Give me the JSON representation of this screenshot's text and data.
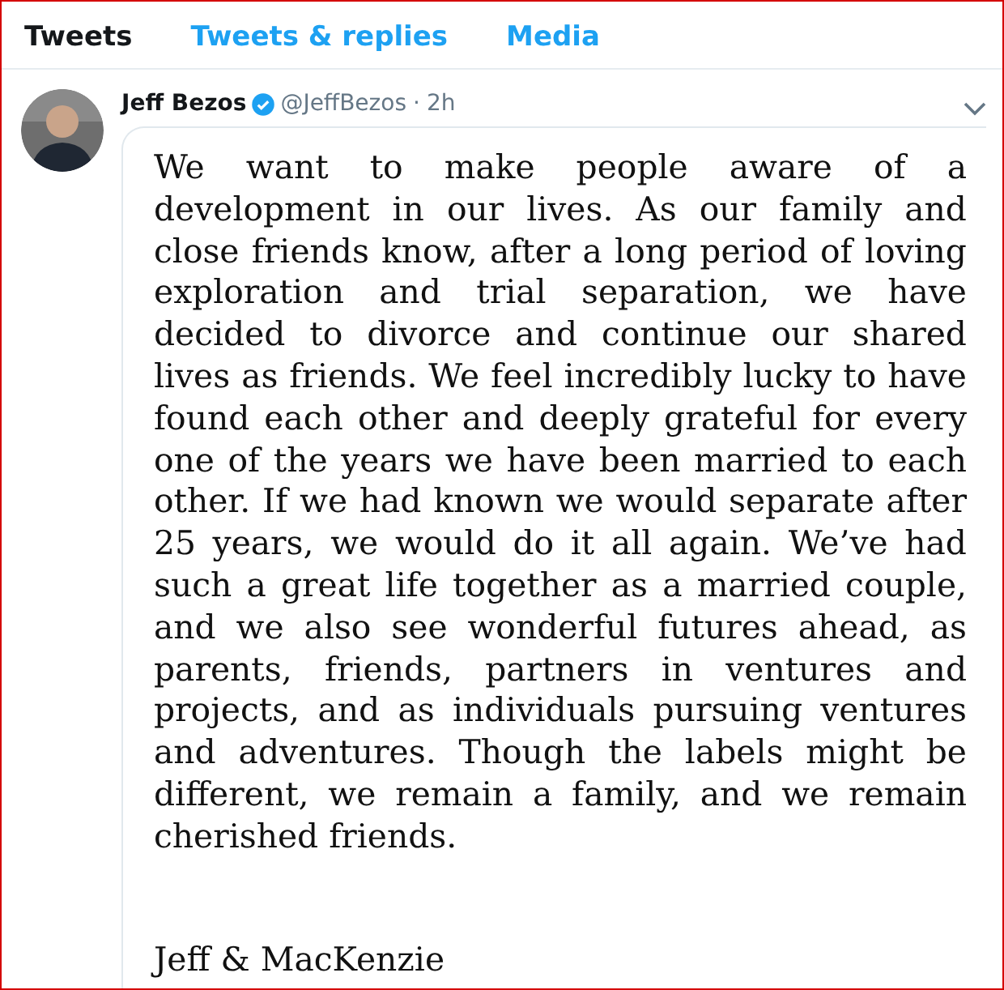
{
  "tabs": [
    {
      "label": "Tweets",
      "selected": true
    },
    {
      "label": "Tweets & replies",
      "selected": false
    },
    {
      "label": "Media",
      "selected": false
    }
  ],
  "tweet": {
    "author": "Jeff Bezos",
    "verified": true,
    "handle": "@JeffBezos",
    "separator": "·",
    "time": "2h",
    "statement": {
      "body": "We want to make people aware of a development in our lives. As our family and close friends know, after a long period of loving exploration and trial separation, we have decided to divorce and continue our shared lives as friends.  We feel incredibly lucky to have found each other and deeply grateful for every one of the years we have been married to each other.  If we had known we would separate after 25 years, we would do it all again.  We’ve had such a great life together as a married couple, and we also see wonderful futures ahead, as parents, friends, partners in ventures and projects, and as individuals pursuing ventures and adventures.  Though the labels might be different, we remain a family, and we remain cherished friends.",
      "signature": "Jeff & MacKenzie"
    }
  }
}
